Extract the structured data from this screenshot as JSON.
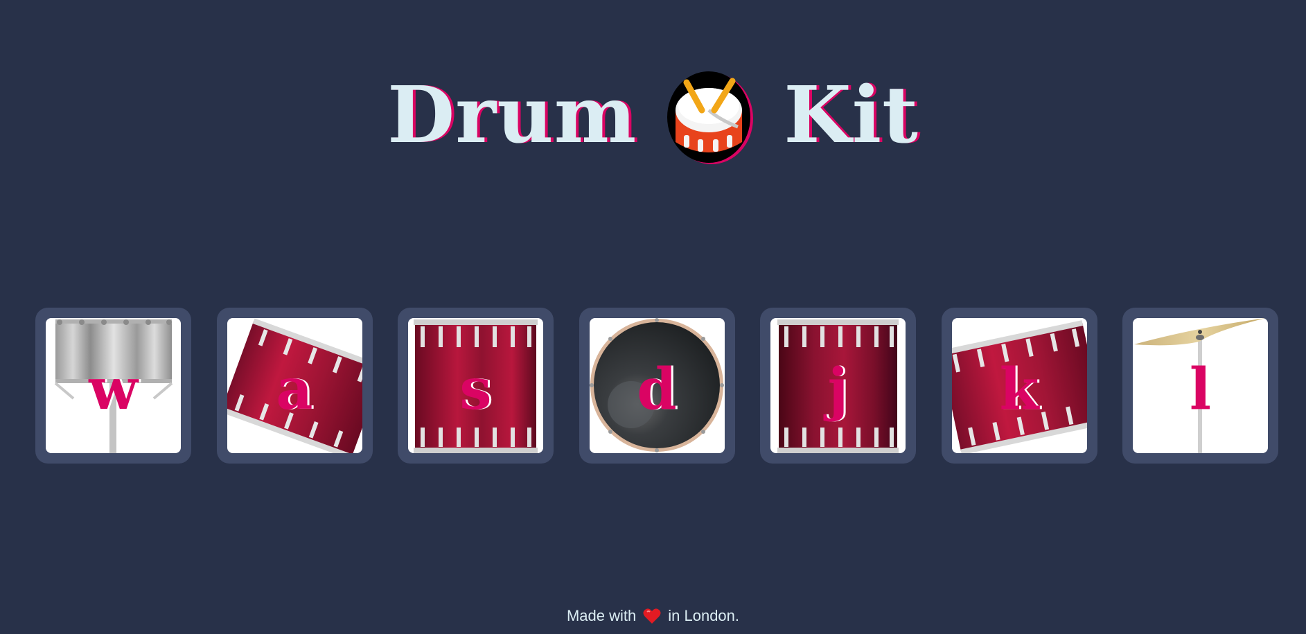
{
  "header": {
    "title_left": "Drum",
    "title_emoji": "drum-icon",
    "title_right": "Kit"
  },
  "drums": [
    {
      "key": "w",
      "instrument_icon": "tom-drum-icon"
    },
    {
      "key": "a",
      "instrument_icon": "tilted-tom-drum-icon"
    },
    {
      "key": "s",
      "instrument_icon": "floor-tom-drum-icon"
    },
    {
      "key": "d",
      "instrument_icon": "kick-drum-icon"
    },
    {
      "key": "j",
      "instrument_icon": "snare-drum-icon"
    },
    {
      "key": "k",
      "instrument_icon": "tilted-tom-drum-icon"
    },
    {
      "key": "l",
      "instrument_icon": "crash-cymbal-icon"
    }
  ],
  "footer": {
    "prefix": "Made with",
    "icon": "heart-icon",
    "suffix": "in London."
  },
  "colors": {
    "background": "#283149",
    "button_frame": "#404b69",
    "accent": "#da0463",
    "title_text": "#dbedf3",
    "drum_red": "#a0163a"
  }
}
